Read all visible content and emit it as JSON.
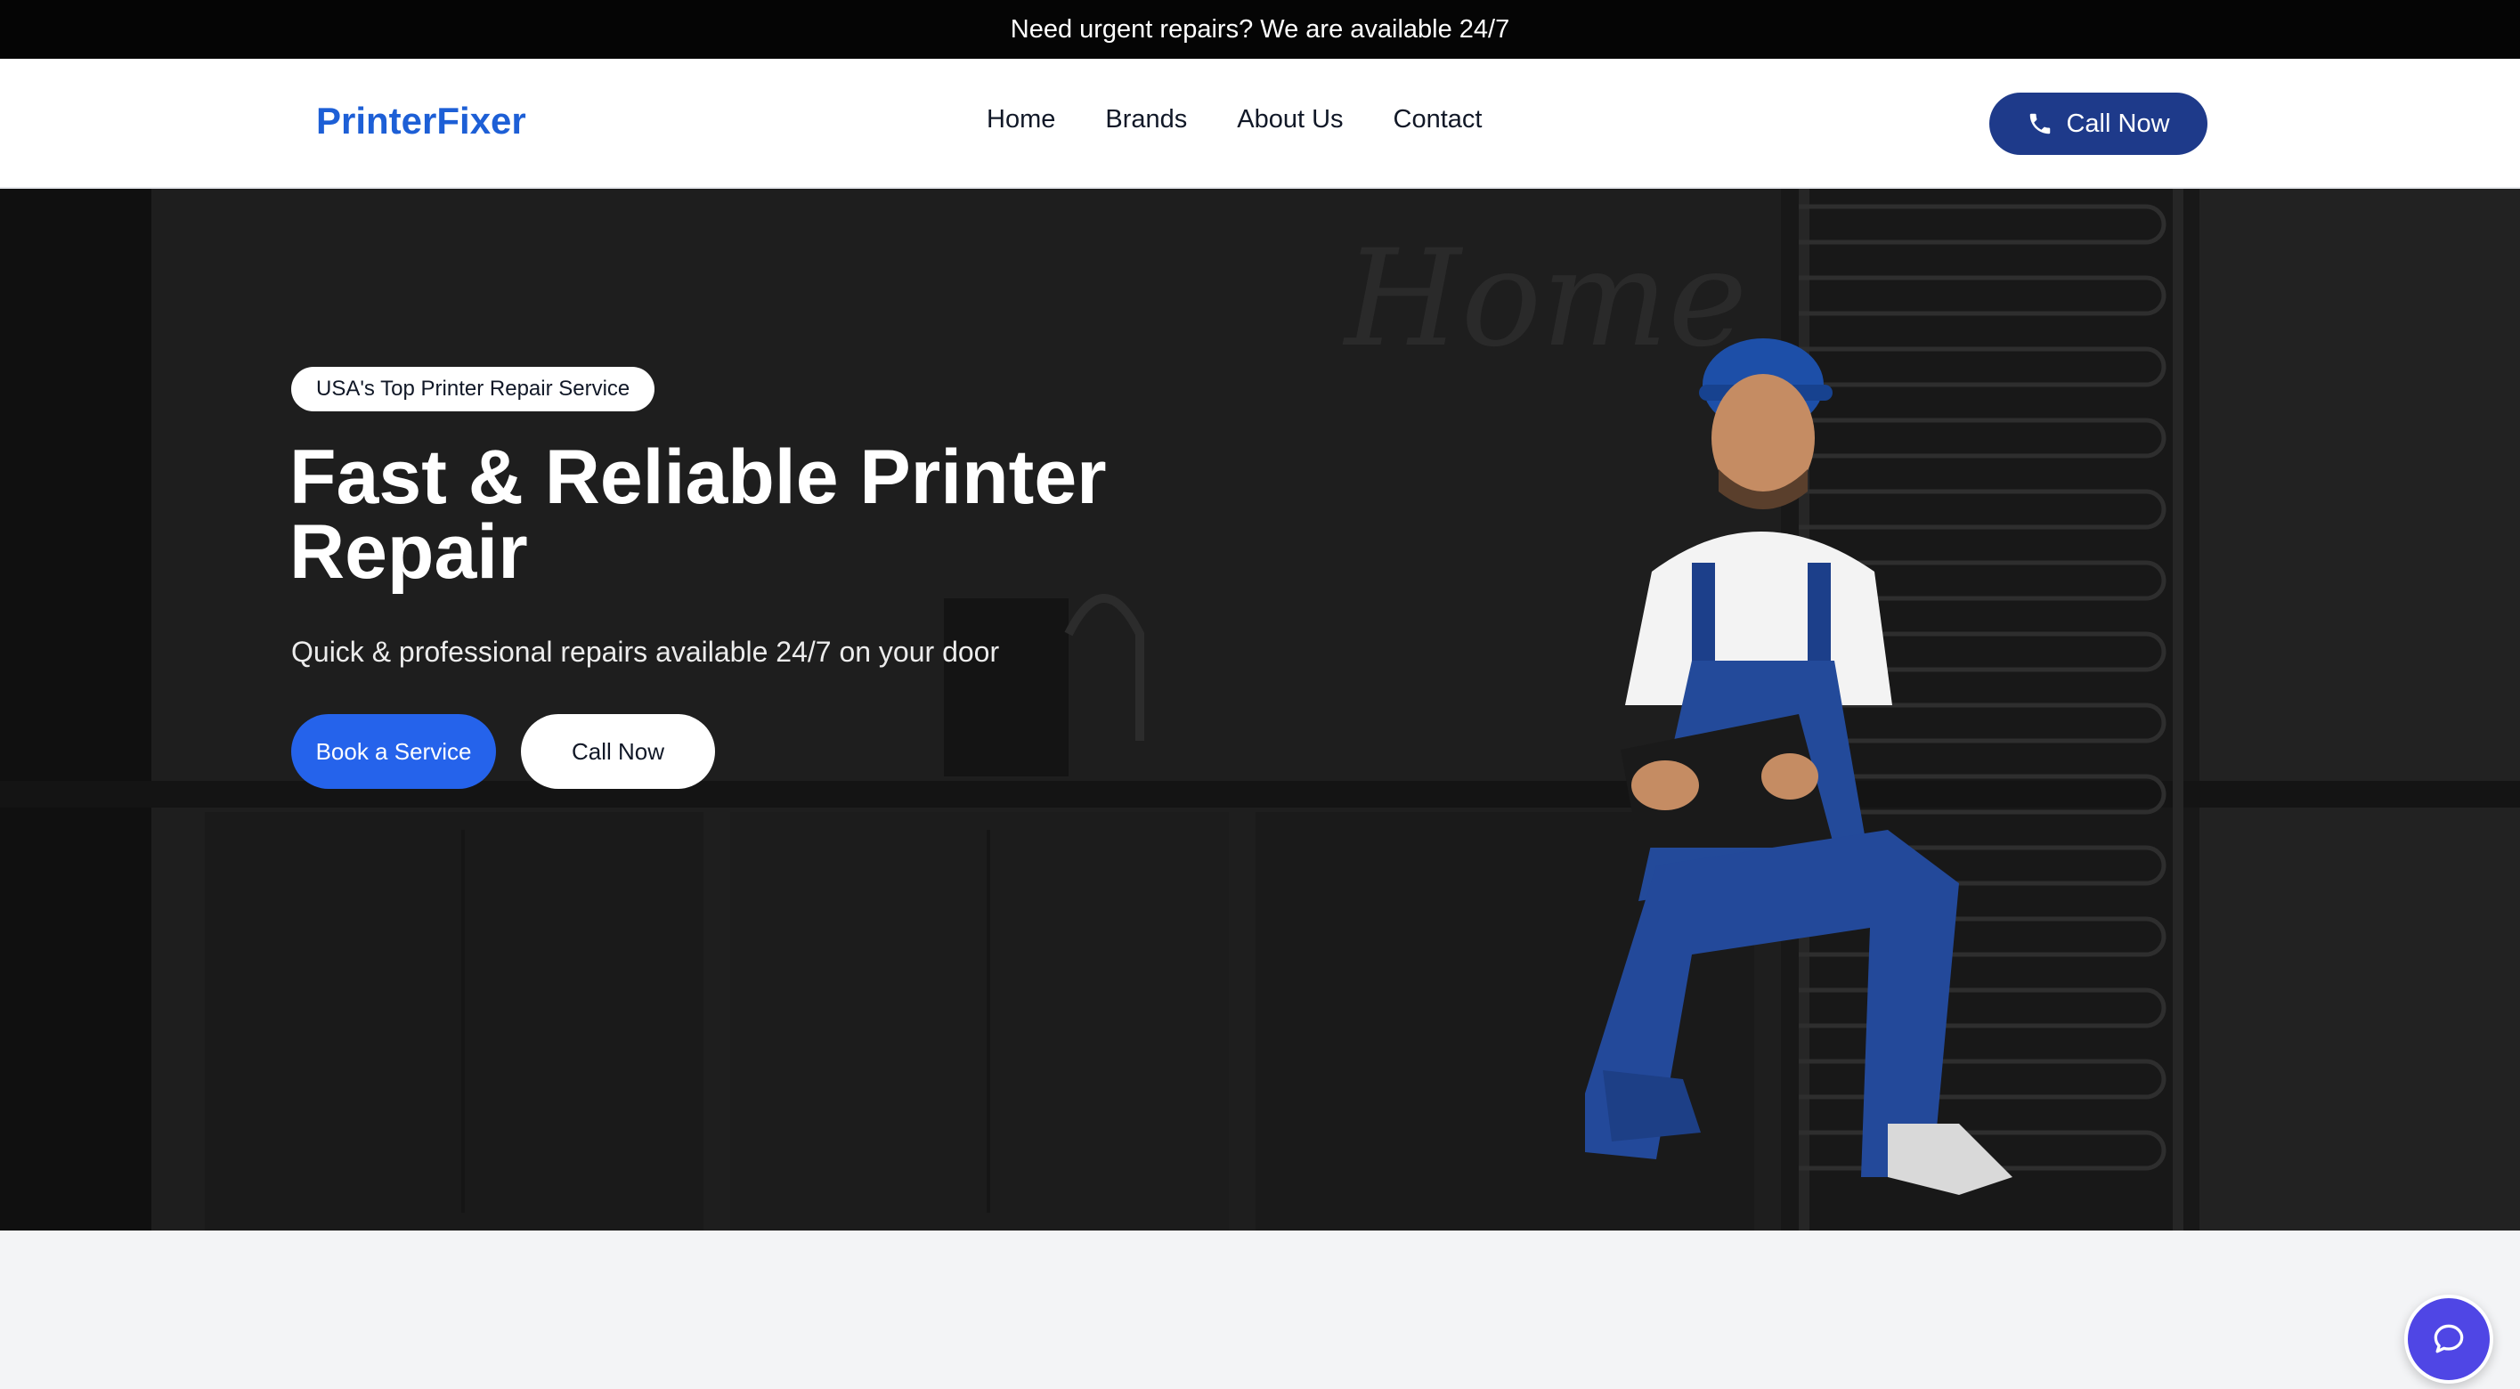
{
  "announcement": {
    "text": "Need urgent repairs? We are available 24/7"
  },
  "header": {
    "logo": "PrinterFixer",
    "nav": [
      {
        "label": "Home"
      },
      {
        "label": "Brands"
      },
      {
        "label": "About Us"
      },
      {
        "label": "Contact"
      }
    ],
    "call_button": {
      "label": "Call Now",
      "icon": "phone-icon"
    }
  },
  "hero": {
    "badge": "USA's Top Printer Repair Service",
    "title": "Fast & Reliable Printer Repair",
    "subtitle": "Quick & professional repairs available 24/7 on your door",
    "primary_button": "Book a Service",
    "secondary_button": "Call Now",
    "background_wall_text": "Home"
  },
  "chat_widget": {
    "icon": "chat-bubble-icon"
  },
  "colors": {
    "brand": "#1d5fd6",
    "nav_button": "#1e3a8a",
    "primary_button": "#2563eb",
    "chat": "#4f46e5",
    "announcement_bg": "#050505"
  }
}
